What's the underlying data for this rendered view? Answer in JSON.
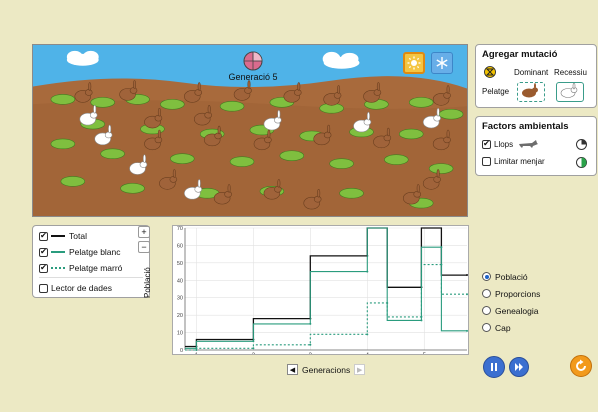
{
  "scene": {
    "generation_label": "Generació 5",
    "sky_color": "#52b6ea",
    "ground_color": "#a86a3c",
    "environment_buttons": [
      {
        "icon": "sun-icon",
        "active": true
      },
      {
        "icon": "snowflake-icon",
        "active": false
      }
    ]
  },
  "mutation_panel": {
    "title": "Agregar mutació",
    "dominant_label": "Dominant",
    "recessive_label": "Recessiu",
    "trait_label": "Pelatge"
  },
  "factors_panel": {
    "title": "Factors ambientals",
    "wolves_label": "Llops",
    "wolves_checked": true,
    "limit_food_label": "Limitar menjar",
    "limit_food_checked": false
  },
  "legend": {
    "items": [
      {
        "label": "Total",
        "checked": true,
        "color": "#111111",
        "style": "solid"
      },
      {
        "label": "Pelatge blanc",
        "checked": true,
        "color": "#2a9c7e",
        "style": "solid"
      },
      {
        "label": "Pelatge marró",
        "checked": true,
        "color": "#2a9c7e",
        "style": "dotted"
      }
    ],
    "data_probe_label": "Lector de dades",
    "data_probe_checked": false
  },
  "zoom": {
    "in_label": "+",
    "out_label": "−"
  },
  "graph": {
    "y_axis_label": "Població",
    "x_axis_label": "Generacions"
  },
  "chart_data": {
    "type": "line",
    "xlabel": "Generacions",
    "ylabel": "Població",
    "xlim": [
      0.8,
      5.75
    ],
    "ylim": [
      0,
      70
    ],
    "x_ticks": [
      1,
      2,
      3,
      4,
      5
    ],
    "y_ticks": [
      0,
      10,
      20,
      30,
      40,
      50,
      60,
      70
    ],
    "grid": true,
    "series": [
      {
        "name": "Total",
        "color": "#111111",
        "dash": "",
        "points": [
          [
            0.8,
            2
          ],
          [
            1,
            2
          ],
          [
            1,
            6
          ],
          [
            2,
            6
          ],
          [
            2,
            18
          ],
          [
            3,
            18
          ],
          [
            3,
            54
          ],
          [
            4,
            54
          ],
          [
            4,
            72
          ],
          [
            4.35,
            72
          ],
          [
            4.35,
            36
          ],
          [
            4.95,
            36
          ],
          [
            4.95,
            72
          ],
          [
            5.3,
            72
          ],
          [
            5.3,
            43
          ],
          [
            5.75,
            43
          ]
        ]
      },
      {
        "name": "Pelatge blanc",
        "color": "#2a9c7e",
        "dash": "",
        "points": [
          [
            0.8,
            1
          ],
          [
            1,
            1
          ],
          [
            1,
            5
          ],
          [
            2,
            5
          ],
          [
            2,
            15
          ],
          [
            3,
            15
          ],
          [
            3,
            45
          ],
          [
            4,
            45
          ],
          [
            4,
            72
          ],
          [
            4.35,
            72
          ],
          [
            4.35,
            17
          ],
          [
            4.95,
            17
          ],
          [
            4.95,
            59
          ],
          [
            5.3,
            59
          ],
          [
            5.3,
            11
          ],
          [
            5.75,
            11
          ]
        ]
      },
      {
        "name": "Pelatge marró",
        "color": "#2a9c7e",
        "dash": "2,2",
        "points": [
          [
            0.8,
            0
          ],
          [
            1,
            0
          ],
          [
            1,
            1
          ],
          [
            2,
            1
          ],
          [
            2,
            3
          ],
          [
            3,
            3
          ],
          [
            3,
            9
          ],
          [
            4,
            9
          ],
          [
            4,
            27
          ],
          [
            4.35,
            27
          ],
          [
            4.35,
            19
          ],
          [
            4.95,
            19
          ],
          [
            4.95,
            49
          ],
          [
            5.3,
            49
          ],
          [
            5.3,
            32
          ],
          [
            5.75,
            32
          ]
        ]
      }
    ]
  },
  "view_options": {
    "items": [
      "Població",
      "Proporcions",
      "Genealogia",
      "Cap"
    ],
    "selected": "Població"
  }
}
